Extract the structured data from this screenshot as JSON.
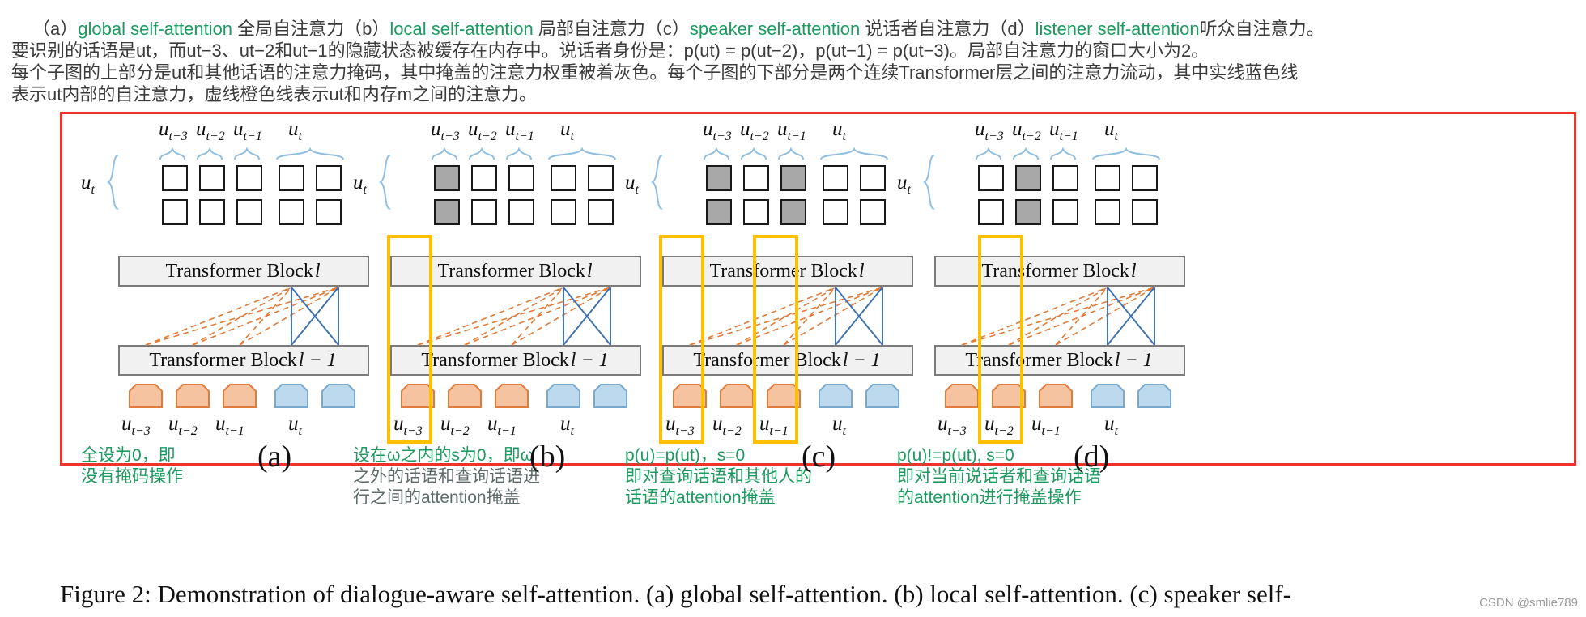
{
  "caption": {
    "line1_parts": [
      {
        "t": "（a）",
        "c": "dark"
      },
      {
        "t": "global self-attention ",
        "c": "green"
      },
      {
        "t": "全局自注意力（b）",
        "c": "dark"
      },
      {
        "t": "local self-attention ",
        "c": "green"
      },
      {
        "t": "局部自注意力（c）",
        "c": "dark"
      },
      {
        "t": "speaker self-attention ",
        "c": "green"
      },
      {
        "t": "说话者自注意力（d）",
        "c": "dark"
      },
      {
        "t": "listener self-attention",
        "c": "green"
      },
      {
        "t": "听众自注意力。",
        "c": "dark"
      }
    ],
    "line2": "要识别的话语是ut，而ut−3、ut−2和ut−1的隐藏状态被缓存在内存中。说话者身份是：p(ut) = p(ut−2)，p(ut−1) = p(ut−3)。局部自注意力的窗口大小为2。",
    "line3": "每个子图的上部分是ut和其他话语的注意力掩码，其中掩盖的注意力权重被着灰色。每个子图的下部分是两个连续Transformer层之间的注意力流动，其中实线蓝色线",
    "line4": "表示ut内部的自注意力，虚线橙色线表示ut和内存m之间的注意力。"
  },
  "figure": {
    "frame_color": "#f0332a",
    "highlight_color": "#ffc000",
    "masked_cell_color": "#a8a8a8",
    "block_upper_label_prefix": "Transformer Block ",
    "block_upper_label_sym": "l",
    "block_lower_label_prefix": "Transformer Block ",
    "block_lower_label_sym": "l − 1",
    "query_label": "u",
    "query_sub": "t",
    "columns": [
      {
        "name": "u",
        "sub": "t−3"
      },
      {
        "name": "u",
        "sub": "t−2"
      },
      {
        "name": "u",
        "sub": "t−1"
      },
      {
        "name": "u",
        "sub": "t"
      }
    ],
    "panels": [
      {
        "id": "a",
        "sublabel": "(a)",
        "mask": [
          [
            false,
            false,
            false,
            false,
            false
          ],
          [
            false,
            false,
            false,
            false,
            false
          ]
        ],
        "note_lines": [
          "全设为0，即",
          "没有掩码操作"
        ],
        "note_color": "green",
        "highlights": []
      },
      {
        "id": "b",
        "sublabel": "(b)",
        "mask": [
          [
            true,
            false,
            false,
            false,
            false
          ],
          [
            true,
            false,
            false,
            false,
            false
          ]
        ],
        "note_lines": [
          "设在ω之内的s为0，即ω",
          "之外的话语和查询话语进",
          "行之间的attention掩盖"
        ],
        "note_color": "mixed",
        "highlights": [
          "col0"
        ]
      },
      {
        "id": "c",
        "sublabel": "(c)",
        "mask": [
          [
            true,
            false,
            true,
            false,
            false
          ],
          [
            true,
            false,
            true,
            false,
            false
          ]
        ],
        "note_lines": [
          "p(u)=p(ut)，s=0",
          "即对查询话语和其他人的",
          "话语的attention掩盖"
        ],
        "note_color": "green",
        "highlights": [
          "col0",
          "col2"
        ]
      },
      {
        "id": "d",
        "sublabel": "(d)",
        "mask": [
          [
            false,
            true,
            false,
            false,
            false
          ],
          [
            false,
            true,
            false,
            false,
            false
          ]
        ],
        "note_lines": [
          "p(u)!=p(ut), s=0",
          "即对当前说话者和查询话语",
          "的attention进行掩盖操作"
        ],
        "note_color": "green",
        "highlights": [
          "col1"
        ]
      }
    ],
    "token_colors": {
      "memory": "#f6c3a0",
      "memory_stroke": "#e07b39",
      "current": "#bcd9ee",
      "current_stroke": "#7aa9cf"
    },
    "edge_colors": {
      "self_attention": "#3b6fb0",
      "memory_attention": "#e07b39"
    }
  },
  "paper_caption": "Figure 2: Demonstration of dialogue-aware self-attention. (a) global self-attention. (b) local self-attention. (c) speaker self-",
  "watermark": "CSDN @smlie789"
}
